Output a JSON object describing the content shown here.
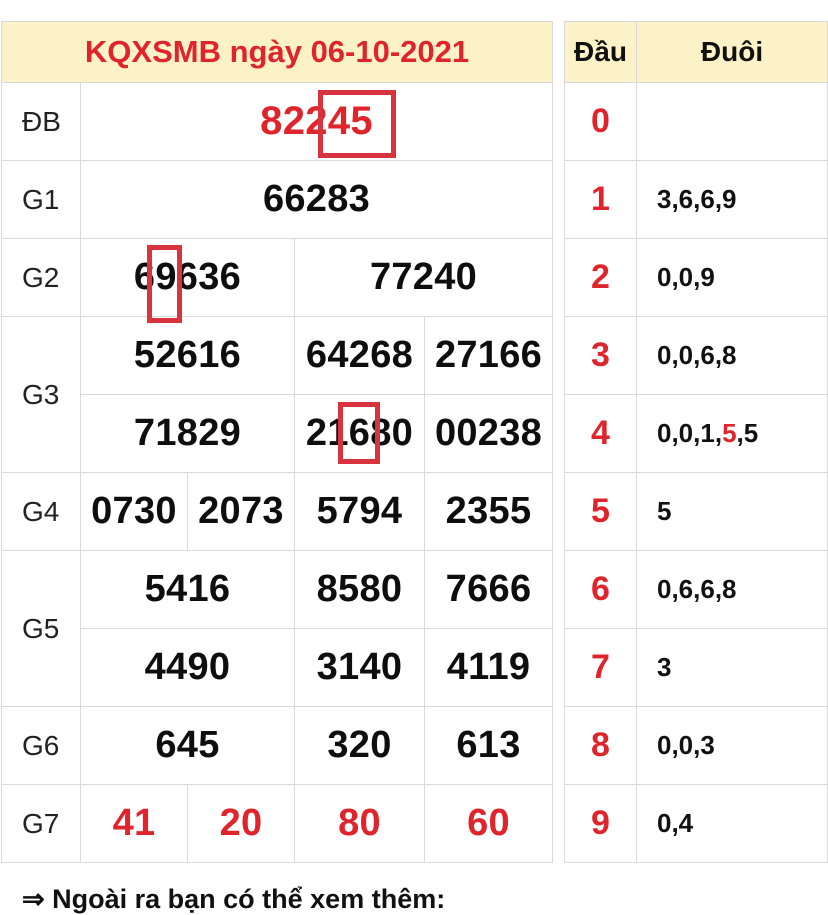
{
  "results": {
    "title": "KQXSMB ngày 06-10-2021",
    "db": {
      "label": "ĐB",
      "value": "82245"
    },
    "g1": {
      "label": "G1",
      "values": [
        "66283"
      ]
    },
    "g2": {
      "label": "G2",
      "values": [
        "69636",
        "77240"
      ]
    },
    "g3": {
      "label": "G3",
      "values": [
        "52616",
        "64268",
        "27166",
        "71829",
        "21680",
        "00238"
      ]
    },
    "g4": {
      "label": "G4",
      "values": [
        "0730",
        "2073",
        "5794",
        "2355"
      ]
    },
    "g5": {
      "label": "G5",
      "values": [
        "5416",
        "8580",
        "7666",
        "4490",
        "3140",
        "4119"
      ]
    },
    "g6": {
      "label": "G6",
      "values": [
        "645",
        "320",
        "613"
      ]
    },
    "g7": {
      "label": "G7",
      "values": [
        "41",
        "20",
        "80",
        "60"
      ]
    }
  },
  "loto": {
    "header_dau": "Đầu",
    "header_duoi": "Đuôi",
    "rows": [
      {
        "dau": "0",
        "duoi": ""
      },
      {
        "dau": "1",
        "duoi": "3,6,6,9"
      },
      {
        "dau": "2",
        "duoi": "0,0,9"
      },
      {
        "dau": "3",
        "duoi": "0,0,6,8"
      },
      {
        "dau": "4",
        "duoi_a": "0,0,1,",
        "duoi_b": "5",
        "duoi_c": ",5"
      },
      {
        "dau": "5",
        "duoi": "5"
      },
      {
        "dau": "6",
        "duoi": "0,6,6,8"
      },
      {
        "dau": "7",
        "duoi": "3"
      },
      {
        "dau": "8",
        "duoi": "0,0,3"
      },
      {
        "dau": "9",
        "duoi": "0,4"
      }
    ]
  },
  "footer": {
    "more_text": "⇒ Ngoài ra bạn có thể xem thêm:"
  },
  "colors": {
    "accent_red": "#e0242b",
    "header_bg": "#fcf2c8",
    "border": "#d9d9d9"
  }
}
